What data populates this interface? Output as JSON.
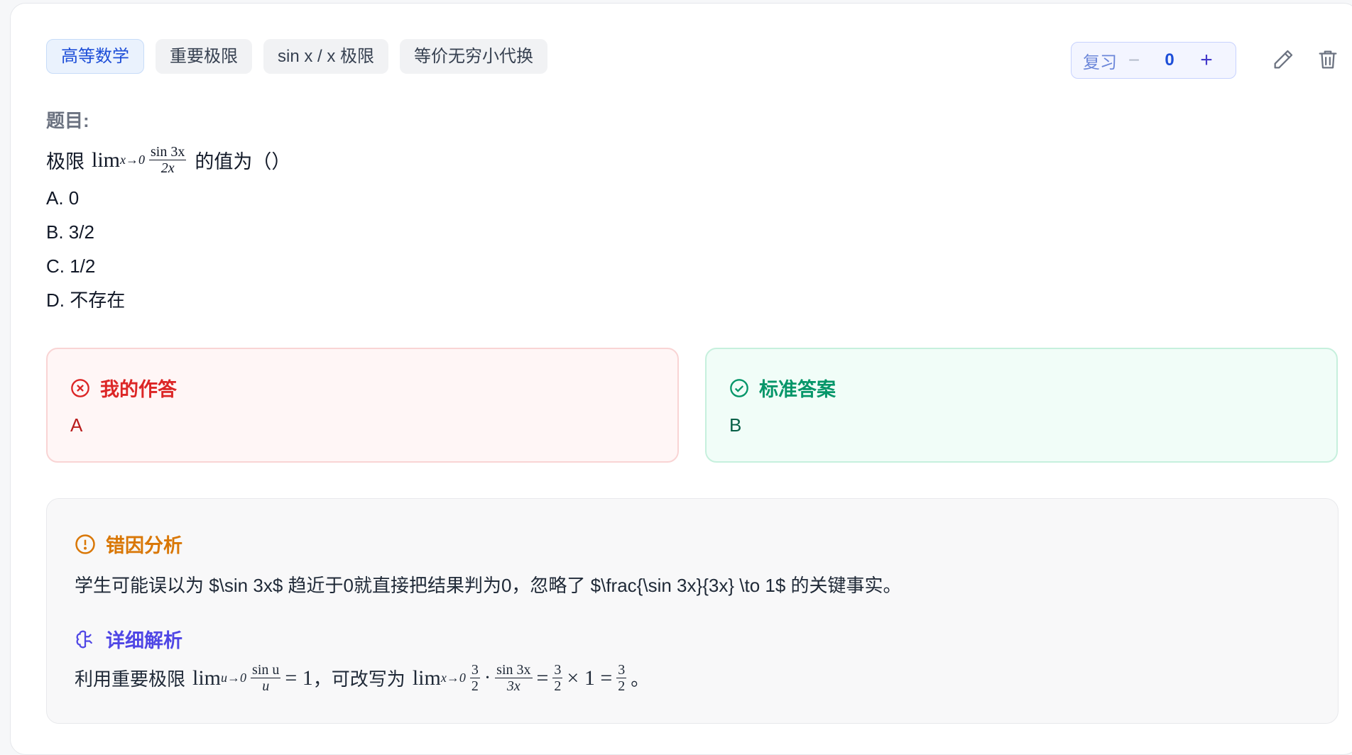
{
  "tags": [
    "高等数学",
    "重要极限",
    "sin x / x 极限",
    "等价无穷小代换"
  ],
  "review": {
    "label": "复习",
    "minus": "−",
    "count": "0",
    "plus": "+"
  },
  "toolbar": {
    "edit_icon": "pencil-icon",
    "delete_icon": "trash-icon"
  },
  "question": {
    "label": "题目:",
    "stem_prefix": "极限",
    "lim": "lim",
    "lim_sub": "x→0",
    "frac_num": "sin 3x",
    "frac_den": "2x",
    "stem_suffix": "的值为（）",
    "options": [
      "A. 0",
      "B. 3/2",
      "C. 1/2",
      "D. 不存在"
    ]
  },
  "my_answer": {
    "title": "我的作答",
    "value": "A",
    "icon": "x-circle-icon",
    "color": "#dc2626"
  },
  "standard_answer": {
    "title": "标准答案",
    "value": "B",
    "icon": "check-circle-icon",
    "color": "#059669"
  },
  "error_analysis": {
    "title": "错因分析",
    "icon": "alert-circle-icon",
    "text": "学生可能误以为 $\\sin 3x$ 趋近于0就直接把结果判为0，忽略了 $\\frac{\\sin 3x}{3x} \\to 1$ 的关键事实。"
  },
  "detailed": {
    "title": "详细解析",
    "icon": "brain-icon",
    "prefix": "利用重要极限",
    "lim": "lim",
    "sub1": "u→0",
    "f1_num": "sin u",
    "f1_den": "u",
    "eq1": "= 1",
    "middle": "，可改写为",
    "sub2": "x→0",
    "f2_num": "3",
    "f2_den": "2",
    "dot": "·",
    "f3_num": "sin 3x",
    "f3_den": "3x",
    "eq2": "=",
    "f4_num": "3",
    "f4_den": "2",
    "times": "× 1 =",
    "f5_num": "3",
    "f5_den": "2",
    "end": "。"
  }
}
